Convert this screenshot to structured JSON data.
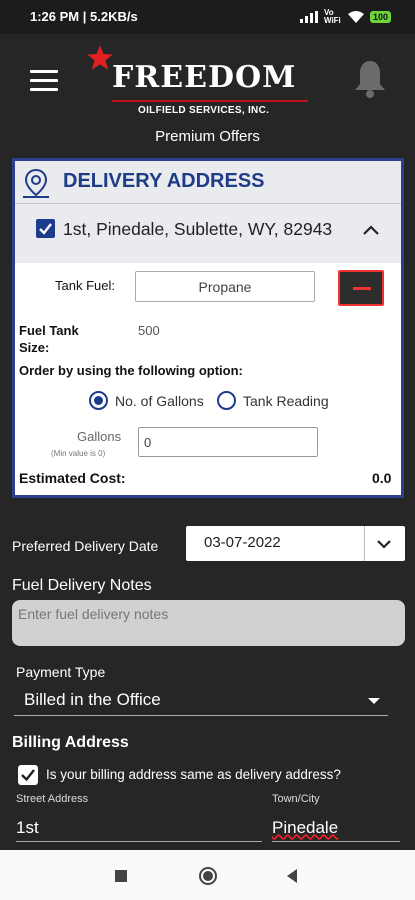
{
  "status_bar": {
    "time": "1:26 PM | 5.2KB/s",
    "network_label": "Vo WiFi",
    "battery": "100"
  },
  "header": {
    "logo_title": "FREEDOM",
    "logo_subtitle": "OILFIELD SERVICES, INC.",
    "premium_link": "Premium Offers"
  },
  "delivery_card": {
    "title": "DELIVERY ADDRESS",
    "address": "1st, Pinedale, Sublette, WY, 82943",
    "tank_fuel_label": "Tank Fuel:",
    "tank_fuel_value": "Propane",
    "tank_size_label_1": "Fuel Tank",
    "tank_size_label_2": "Size:",
    "tank_size_value": "500",
    "order_by_label": "Order by using the following option:",
    "option_gallons": "No. of Gallons",
    "option_tank_reading": "Tank Reading",
    "gallons_label": "Gallons",
    "gallons_hint": "(Min value is 0)",
    "gallons_value": "0",
    "estimated_cost_label": "Estimated Cost:",
    "estimated_cost_value": "0.0"
  },
  "form": {
    "delivery_date_label": "Preferred Delivery Date",
    "delivery_date_value": "03-07-2022",
    "notes_label": "Fuel Delivery Notes",
    "notes_placeholder": "Enter fuel delivery notes",
    "payment_type_label": "Payment Type",
    "payment_type_value": "Billed in the Office",
    "billing_address_label": "Billing Address",
    "billing_same_label": "Is your billing address same as delivery address?",
    "street_label": "Street Address",
    "street_value": "1st",
    "city_label": "Town/City",
    "city_value": "Pinedale"
  },
  "colors": {
    "accent_blue": "#1f3c87",
    "brand_red": "#e33333",
    "background": "#262626"
  }
}
